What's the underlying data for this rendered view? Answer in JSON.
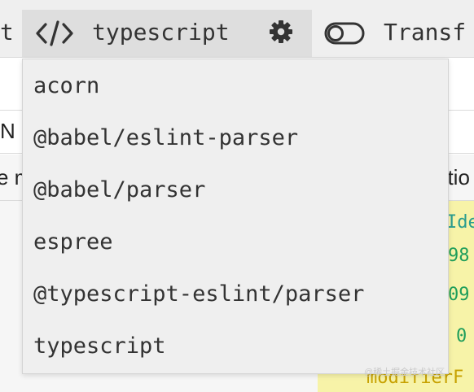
{
  "toolbar": {
    "left_fragment": "t",
    "parser_button": {
      "label": "typescript",
      "icon": "code-icon"
    },
    "settings_icon": "gear-icon",
    "transform_toggle": {
      "label": "Transf",
      "on": false
    }
  },
  "parser_menu": {
    "items": [
      {
        "label": "acorn"
      },
      {
        "label": "@babel/eslint-parser"
      },
      {
        "label": "@babel/parser"
      },
      {
        "label": "espree"
      },
      {
        "label": "@typescript-eslint/parser"
      },
      {
        "label": "typescript"
      }
    ]
  },
  "background": {
    "row1_fragment": "N",
    "row2_left_fragment": "e m",
    "row2_right_fragment": "atio",
    "code_fragments": [
      "Ide",
      "98",
      "09",
      "0",
      "modifierF"
    ]
  },
  "watermark": "@稀土掘金技术社区",
  "colors": {
    "toolbar": "#efefef",
    "active_button": "#dedede",
    "highlight": "#f7f3a8"
  }
}
